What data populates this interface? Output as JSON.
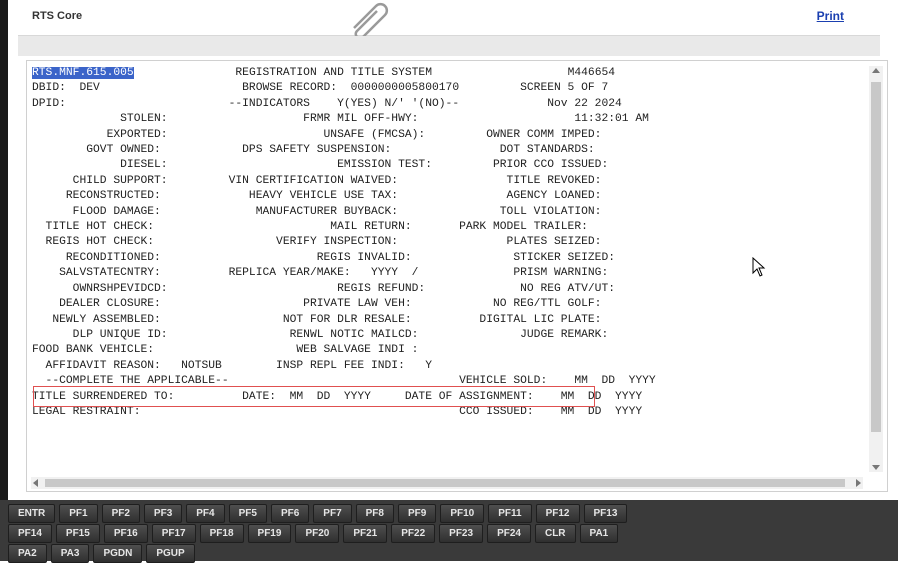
{
  "header": {
    "app_title": "RTS Core",
    "print_label": "Print"
  },
  "screen": {
    "lines": [
      {
        "pre": "",
        "sel": "RTS.MNF.615.005",
        "post": "               REGISTRATION AND TITLE SYSTEM                    M446654"
      },
      {
        "text": "DBID:  DEV                     BROWSE RECORD:  0000000005800170         SCREEN 5 OF 7"
      },
      {
        "text": "DPID:                        --INDICATORS    Y(YES) N/' '(NO)--             Nov 22 2024"
      },
      {
        "text": "             STOLEN:                    FRMR MIL OFF-HWY:                       11:32:01 AM"
      },
      {
        "text": "           EXPORTED:                       UNSAFE (FMCSA):         OWNER COMM IMPED:"
      },
      {
        "text": "        GOVT OWNED:            DPS SAFETY SUSPENSION:                DOT STANDARDS:"
      },
      {
        "text": "             DIESEL:                         EMISSION TEST:         PRIOR CCO ISSUED:"
      },
      {
        "text": "      CHILD SUPPORT:         VIN CERTIFICATION WAIVED:                TITLE REVOKED:"
      },
      {
        "text": "     RECONSTRUCTED:             HEAVY VEHICLE USE TAX:                AGENCY LOANED:"
      },
      {
        "text": "      FLOOD DAMAGE:              MANUFACTURER BUYBACK:               TOLL VIOLATION:"
      },
      {
        "text": "  TITLE HOT CHECK:                          MAIL RETURN:       PARK MODEL TRAILER:"
      },
      {
        "text": "  REGIS HOT CHECK:                  VERIFY INSPECTION:                PLATES SEIZED:"
      },
      {
        "text": "     RECONDITIONED:                       REGIS INVALID:               STICKER SEIZED:"
      },
      {
        "text": "    SALVSTATECNTRY:          REPLICA YEAR/MAKE:   YYYY  /              PRISM WARNING:"
      },
      {
        "text": "      OWNRSHPEVIDCD:                         REGIS REFUND:              NO REG ATV/UT:"
      },
      {
        "text": "    DEALER CLOSURE:                     PRIVATE LAW VEH:            NO REG/TTL GOLF:"
      },
      {
        "text": "   NEWLY ASSEMBLED:                  NOT FOR DLR RESALE:          DIGITAL LIC PLATE:"
      },
      {
        "text": "      DLP UNIQUE ID:                  RENWL NOTIC MAILCD:               JUDGE REMARK:"
      },
      {
        "text": "FOOD BANK VEHICLE:                     WEB SALVAGE INDI :"
      },
      {
        "text": "  AFFIDAVIT REASON:   NOTSUB        INSP REPL FEE INDI:   Y"
      },
      {
        "text": "  --COMPLETE THE APPLICABLE--                                  VEHICLE SOLD:    MM  DD  YYYY"
      },
      {
        "text": "TITLE SURRENDERED TO:          DATE:  MM  DD  YYYY     DATE OF ASSIGNMENT:    MM  DD  YYYY"
      },
      {
        "text": "LEGAL RESTRAINT:                                               CCO ISSUED:    MM  DD  YYYY"
      }
    ]
  },
  "function_keys": {
    "row1": [
      "ENTR",
      "PF1",
      "PF2",
      "PF3",
      "PF4",
      "PF5",
      "PF6",
      "PF7",
      "PF8",
      "PF9",
      "PF10",
      "PF11",
      "PF12",
      "PF13"
    ],
    "row2": [
      "PF14",
      "PF15",
      "PF16",
      "PF17",
      "PF18",
      "PF19",
      "PF20",
      "PF21",
      "PF22",
      "PF23",
      "PF24",
      "CLR",
      "PA1"
    ],
    "row3": [
      "PA2",
      "PA3",
      "PGDN",
      "PGUP"
    ]
  },
  "colors": {
    "key_bg": "#3a3a3a",
    "selection": "#3b64c9",
    "highlight_box": "#e05050",
    "link": "#1a3fb0"
  }
}
